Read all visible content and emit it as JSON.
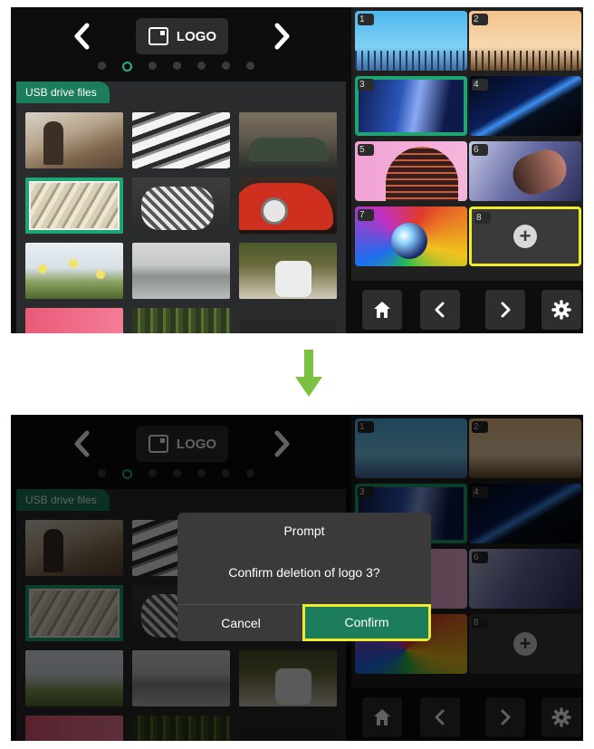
{
  "header": {
    "logo_label": "LOGO",
    "prev_icon": "chevron-left-icon",
    "next_icon": "chevron-right-icon",
    "page_dots_count": 7,
    "active_dot_index": 1
  },
  "usb_panel": {
    "tab_label": "USB drive files",
    "selected_index": 3,
    "thumbnails": [
      "desert-person",
      "building-balconies",
      "green-car",
      "striped-building",
      "striped-pillow",
      "red-car",
      "daisies",
      "misty-lake",
      "person-sneakers",
      "pink-wall",
      "forest",
      "dark-plants"
    ]
  },
  "logo_slots": [
    {
      "number": "1",
      "image": "blue-sky-grass"
    },
    {
      "number": "2",
      "image": "orange-sky-grass"
    },
    {
      "number": "3",
      "image": "blue-abstract"
    },
    {
      "number": "4",
      "image": "dark-blue-gradient"
    },
    {
      "number": "5",
      "image": "pink-building"
    },
    {
      "number": "6",
      "image": "motion-dancer"
    },
    {
      "number": "7",
      "image": "glass-sphere"
    },
    {
      "number": "8",
      "image": "empty-add"
    }
  ],
  "bottom_bar": {
    "home_icon": "home-icon",
    "prev_icon": "chevron-left-icon",
    "next_icon": "chevron-right-icon",
    "settings_icon": "gear-icon"
  },
  "dialog": {
    "title": "Prompt",
    "message": "Confirm deletion of logo 3?",
    "cancel_label": "Cancel",
    "confirm_label": "Confirm"
  },
  "colors": {
    "accent_green": "#1b7d5c",
    "highlight_yellow": "#f1ec2b",
    "transition_arrow": "#7cc242"
  }
}
